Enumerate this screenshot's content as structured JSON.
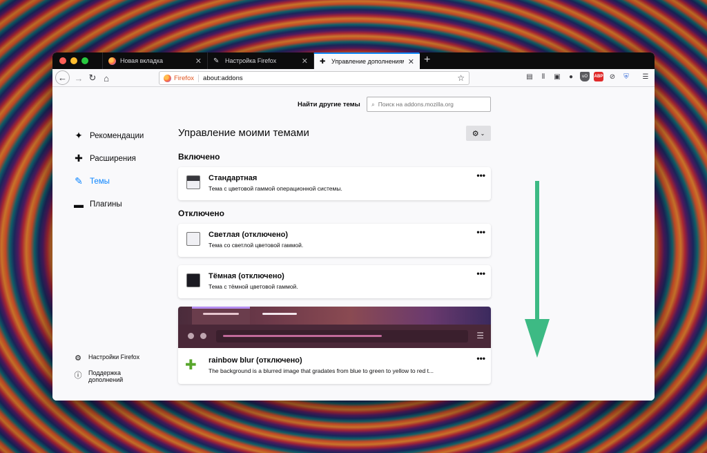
{
  "window": {
    "tabs": [
      {
        "label": "Новая вкладка"
      },
      {
        "label": "Настройка Firefox"
      },
      {
        "label": "Управление дополнениями"
      }
    ],
    "new_tab": "+"
  },
  "navbar": {
    "url_brand": "Firefox",
    "url": "about:addons"
  },
  "search": {
    "label": "Найти другие темы",
    "placeholder": "Поиск на addons.mozilla.org"
  },
  "sidebar": {
    "items": [
      {
        "label": "Рекомендации",
        "icon": "sparkle-puzzle-icon"
      },
      {
        "label": "Расширения",
        "icon": "puzzle-icon"
      },
      {
        "label": "Темы",
        "icon": "brush-icon"
      },
      {
        "label": "Плагины",
        "icon": "plugin-icon"
      }
    ],
    "footer": [
      {
        "label": "Настройки Firefox",
        "icon": "gear-icon"
      },
      {
        "label": "Поддержка дополнений",
        "icon": "help-icon"
      }
    ]
  },
  "main": {
    "title": "Управление моими темами",
    "enabled_heading": "Включено",
    "disabled_heading": "Отключено",
    "enabled": [
      {
        "name": "Стандартная",
        "desc": "Тема с цветовой гаммой операционной системы."
      }
    ],
    "disabled": [
      {
        "name": "Светлая (отключено)",
        "desc": "Тема со светлой цветовой гаммой."
      },
      {
        "name": "Тёмная (отключено)",
        "desc": "Тема с тёмной цветовой гаммой."
      },
      {
        "name": "rainbow blur (отключено)",
        "desc": "The background is a blurred image that gradates from blue to green to yellow to red t..."
      }
    ]
  },
  "colors": {
    "accent": "#0a84ff",
    "arrow": "#3dba84"
  }
}
